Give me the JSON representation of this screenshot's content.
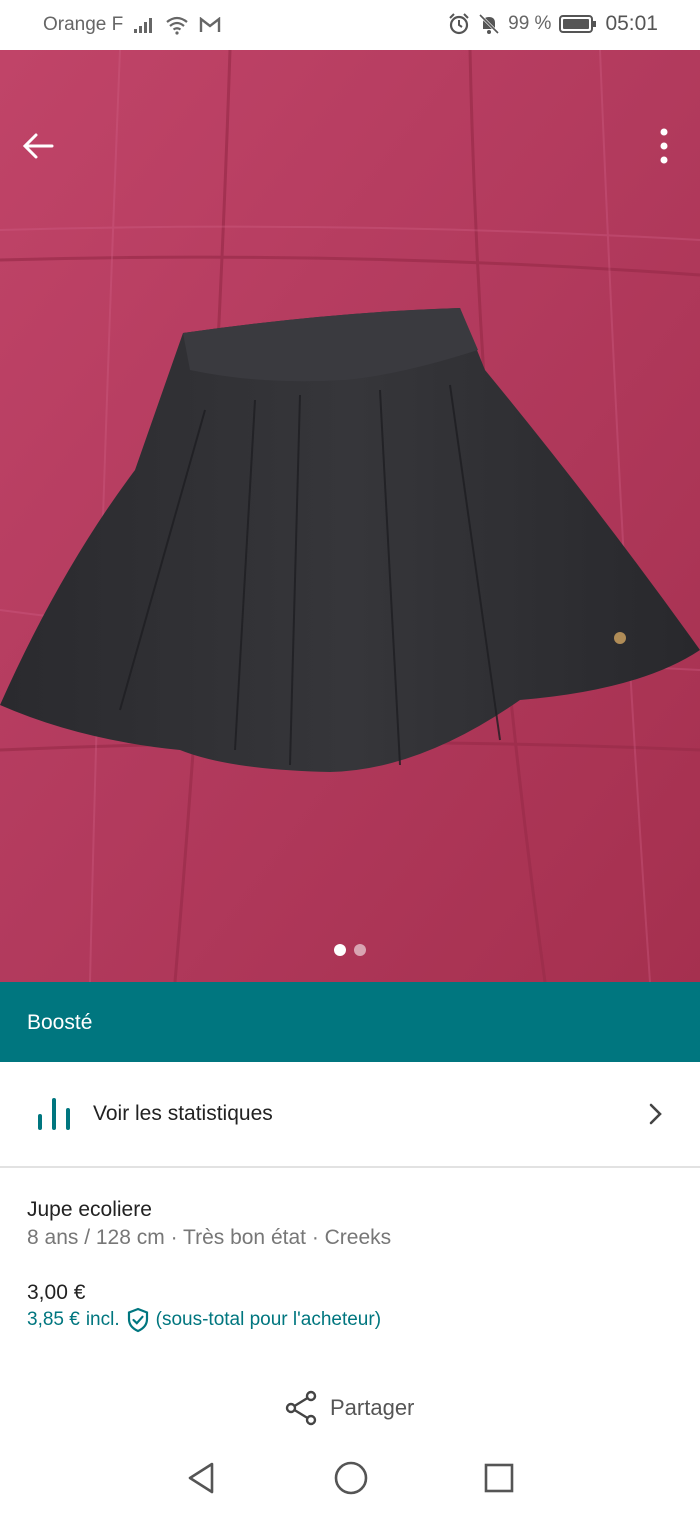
{
  "status_bar": {
    "carrier": "Orange F",
    "battery": "99 %",
    "time": "05:01"
  },
  "gallery": {
    "image_count": 2,
    "active_index": 0
  },
  "boost_banner": {
    "label": "Boosté"
  },
  "stats": {
    "label": "Voir les statistiques"
  },
  "item": {
    "title": "Jupe ecoliere",
    "details": "8 ans / 128 cm · Très bon état · Creeks",
    "price": "3,00 €",
    "buyer_price": "3,85 €",
    "buyer_incl": "incl.",
    "buyer_note": "(sous-total pour l'acheteur)"
  },
  "share": {
    "label": "Partager"
  },
  "colors": {
    "accent": "#00767f",
    "bedspread": "#b53a5e",
    "skirt": "#2f2f33"
  },
  "icons": [
    "back-arrow-icon",
    "more-vertical-icon",
    "stats-bars-icon",
    "chevron-right-icon",
    "shield-check-icon",
    "share-icon",
    "nav-back-icon",
    "nav-home-icon",
    "nav-recents-icon",
    "signal-icon",
    "wifi-icon",
    "alarm-icon",
    "mute-bell-icon",
    "battery-icon"
  ]
}
